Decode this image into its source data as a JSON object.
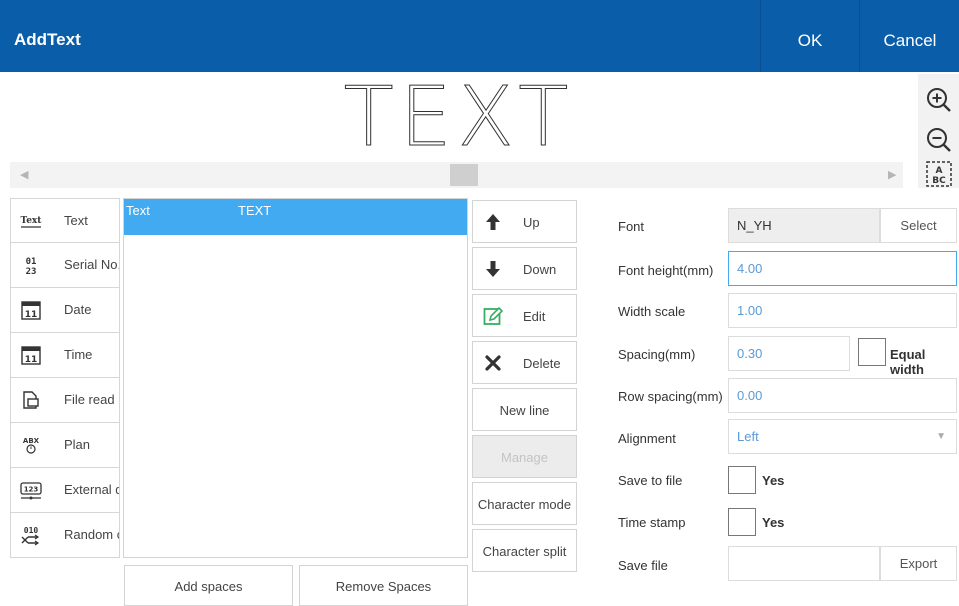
{
  "header": {
    "title": "AddText",
    "ok_label": "OK",
    "cancel_label": "Cancel"
  },
  "preview": {
    "text": "TEXT"
  },
  "type_list": [
    {
      "name": "text",
      "label": "Text",
      "icon": "text-icon"
    },
    {
      "name": "serial-no",
      "label": "Serial No.",
      "icon": "serial-number-icon"
    },
    {
      "name": "date",
      "label": "Date",
      "icon": "calendar-icon"
    },
    {
      "name": "time",
      "label": "Time",
      "icon": "calendar-icon"
    },
    {
      "name": "file-read",
      "label": "File read",
      "icon": "file-read-icon"
    },
    {
      "name": "plan",
      "label": "Plan",
      "icon": "plan-icon"
    },
    {
      "name": "external-data",
      "label": "External d",
      "icon": "external-data-icon"
    },
    {
      "name": "random-code",
      "label": "Random c",
      "icon": "random-icon"
    }
  ],
  "text_list": {
    "rows": [
      {
        "type": "Text",
        "content": "TEXT"
      }
    ]
  },
  "bottom_buttons": {
    "add_spaces": "Add spaces",
    "remove_spaces": "Remove Spaces"
  },
  "actions": {
    "up": "Up",
    "down": "Down",
    "edit": "Edit",
    "delete": "Delete",
    "new_line": "New line",
    "manage": "Manage",
    "character_mode": "Character mode",
    "character_split": "Character split"
  },
  "props": {
    "font_label": "Font",
    "font_value": "N_YH",
    "select_label": "Select",
    "font_height_label": "Font height(mm)",
    "font_height_value": "4.00",
    "width_scale_label": "Width scale",
    "width_scale_value": "1.00",
    "spacing_label": "Spacing(mm)",
    "spacing_value": "0.30",
    "equal_width_label": "Equal width",
    "row_spacing_label": "Row spacing(mm)",
    "row_spacing_value": "0.00",
    "alignment_label": "Alignment",
    "alignment_value": "Left",
    "save_to_file_label": "Save to file",
    "save_to_file_yes": "Yes",
    "time_stamp_label": "Time stamp",
    "time_stamp_yes": "Yes",
    "save_file_label": "Save file",
    "save_file_value": "",
    "export_label": "Export"
  },
  "colors": {
    "header": "#0a5ea9",
    "selected_row": "#42aaf0",
    "value_text": "#5a9ad5"
  }
}
